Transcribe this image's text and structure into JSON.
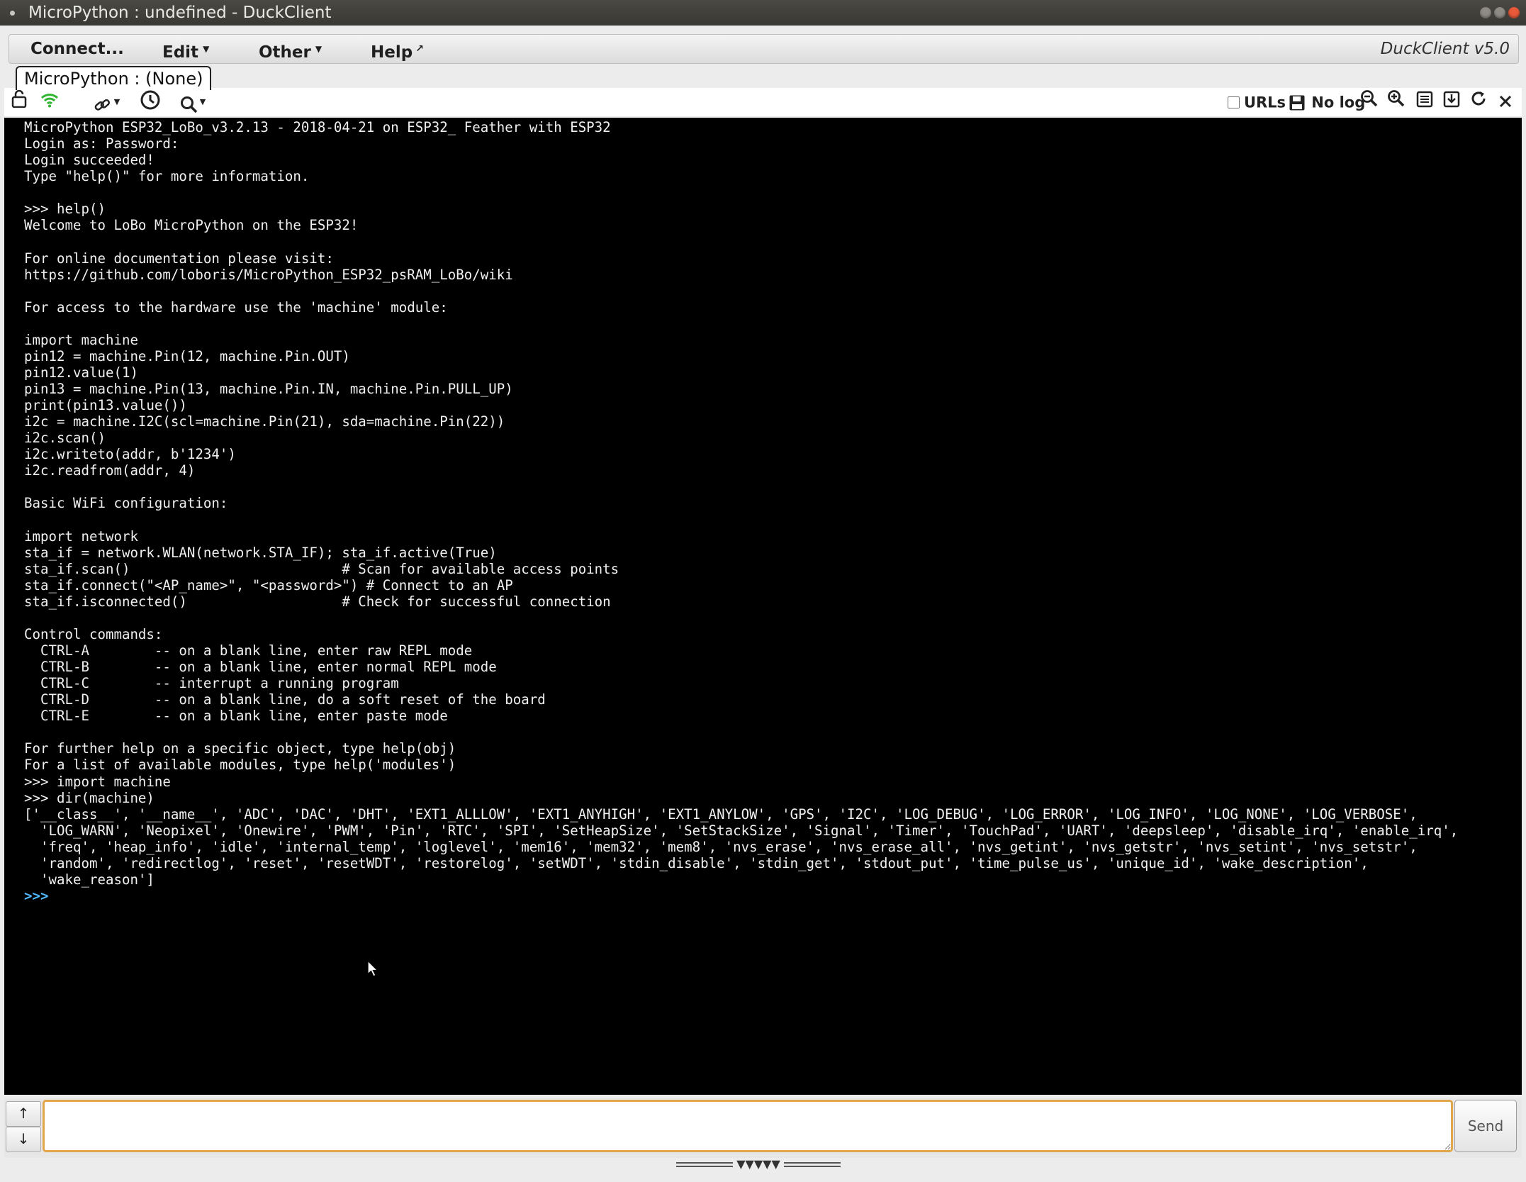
{
  "window": {
    "title": "MicroPython : undefined - DuckClient"
  },
  "menu": {
    "connect": "Connect...",
    "edit": "Edit",
    "other": "Other",
    "help": "Help",
    "app_version": "DuckClient v5.0"
  },
  "tab": {
    "label": "MicroPython : (None)"
  },
  "toolbar": {
    "urls_label": "URLs",
    "log_label": "No log"
  },
  "terminal": {
    "output": "MicroPython ESP32_LoBo_v3.2.13 - 2018-04-21 on ESP32_ Feather with ESP32\nLogin as: Password:\nLogin succeeded!\nType \"help()\" for more information.\n\n>>> help()\nWelcome to LoBo MicroPython on the ESP32!\n\nFor online documentation please visit:\nhttps://github.com/loboris/MicroPython_ESP32_psRAM_LoBo/wiki\n\nFor access to the hardware use the 'machine' module:\n\nimport machine\npin12 = machine.Pin(12, machine.Pin.OUT)\npin12.value(1)\npin13 = machine.Pin(13, machine.Pin.IN, machine.Pin.PULL_UP)\nprint(pin13.value())\ni2c = machine.I2C(scl=machine.Pin(21), sda=machine.Pin(22))\ni2c.scan()\ni2c.writeto(addr, b'1234')\ni2c.readfrom(addr, 4)\n\nBasic WiFi configuration:\n\nimport network\nsta_if = network.WLAN(network.STA_IF); sta_if.active(True)\nsta_if.scan()                          # Scan for available access points\nsta_if.connect(\"<AP_name>\", \"<password>\") # Connect to an AP\nsta_if.isconnected()                   # Check for successful connection\n\nControl commands:\n  CTRL-A        -- on a blank line, enter raw REPL mode\n  CTRL-B        -- on a blank line, enter normal REPL mode\n  CTRL-C        -- interrupt a running program\n  CTRL-D        -- on a blank line, do a soft reset of the board\n  CTRL-E        -- on a blank line, enter paste mode\n\nFor further help on a specific object, type help(obj)\nFor a list of available modules, type help('modules')\n>>> import machine\n>>> dir(machine)\n['__class__', '__name__', 'ADC', 'DAC', 'DHT', 'EXT1_ALLLOW', 'EXT1_ANYHIGH', 'EXT1_ANYLOW', 'GPS', 'I2C', 'LOG_DEBUG', 'LOG_ERROR', 'LOG_INFO', 'LOG_NONE', 'LOG_VERBOSE',\n  'LOG_WARN', 'Neopixel', 'Onewire', 'PWM', 'Pin', 'RTC', 'SPI', 'SetHeapSize', 'SetStackSize', 'Signal', 'Timer', 'TouchPad', 'UART', 'deepsleep', 'disable_irq', 'enable_irq',\n  'freq', 'heap_info', 'idle', 'internal_temp', 'loglevel', 'mem16', 'mem32', 'mem8', 'nvs_erase', 'nvs_erase_all', 'nvs_getint', 'nvs_getstr', 'nvs_setint', 'nvs_setstr',\n  'random', 'redirectlog', 'reset', 'resetWDT', 'restorelog', 'setWDT', 'stdin_disable', 'stdin_get', 'stdout_put', 'time_pulse_us', 'unique_id', 'wake_description',\n  'wake_reason']",
    "prompt": ">>>"
  },
  "input": {
    "value": "",
    "send_label": "Send",
    "history_up": "↑",
    "history_down": "↓"
  },
  "splitter": {
    "arrows": "▼▼▼▼▼"
  },
  "colors": {
    "terminal_bg": "#000000",
    "terminal_fg": "#f0f0f0",
    "prompt": "#4fb8ff",
    "input_focus_border": "#e1a54a",
    "connected_icon": "#2fb52f"
  },
  "icons": {
    "lock": "lock-open-icon",
    "connection": "wifi-icon",
    "link": "link-icon",
    "history": "clock-icon",
    "search": "search-icon",
    "save": "floppy-icon",
    "zoom_out": "zoom-out-icon",
    "zoom_in": "zoom-in-icon",
    "list": "list-icon",
    "download": "download-icon",
    "reload": "reload-icon",
    "close": "close-icon"
  }
}
